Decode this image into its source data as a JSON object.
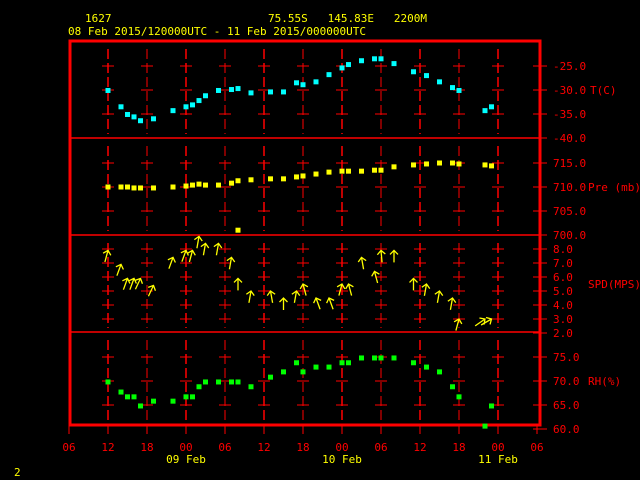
{
  "header": {
    "station": "1627",
    "location": "75.55S   145.83E   2200M",
    "period": "08 Feb 2015/120000UTC - 11 Feb 2015/000000UTC"
  },
  "footer": {
    "page": "2"
  },
  "colors": {
    "frame": "#ff0000",
    "temp": "#00ffff",
    "pres": "#ffff00",
    "wind": "#ffff00",
    "rh": "#00ff00"
  },
  "chart_data": {
    "type": "scatter",
    "title": "1627 75.55S 145.83E 2200M",
    "x_unit": "hours since 08 Feb 2015 12 UTC",
    "x_ticks": [
      "06",
      "12",
      "18",
      "00",
      "06",
      "12",
      "18",
      "00",
      "06",
      "12",
      "18",
      "00",
      "06"
    ],
    "x_tick_hours": [
      -6,
      0,
      6,
      12,
      18,
      24,
      30,
      36,
      42,
      48,
      54,
      60,
      66
    ],
    "x_dates": [
      {
        "label": "09 Feb",
        "hour": 12
      },
      {
        "label": "10 Feb",
        "hour": 36
      },
      {
        "label": "11 Feb",
        "hour": 60
      }
    ],
    "xlim": [
      -6,
      66
    ],
    "panels": [
      {
        "name": "temperature",
        "label": "T(C)",
        "ylim": [
          -40,
          -20
        ],
        "ticks": [
          "-25.0",
          "-30.0",
          "-35.0",
          "-40.0"
        ],
        "tick_values": [
          -25,
          -30,
          -35,
          -40
        ],
        "points": [
          [
            0,
            -30.1
          ],
          [
            2,
            -33.5
          ],
          [
            3,
            -35.1
          ],
          [
            4,
            -35.6
          ],
          [
            5,
            -36.4
          ],
          [
            7,
            -36.0
          ],
          [
            10,
            -34.3
          ],
          [
            12,
            -33.5
          ],
          [
            13,
            -33.1
          ],
          [
            14,
            -32.2
          ],
          [
            15,
            -31.2
          ],
          [
            17,
            -30.1
          ],
          [
            19,
            -29.9
          ],
          [
            20,
            -29.7
          ],
          [
            22,
            -30.6
          ],
          [
            25,
            -30.4
          ],
          [
            27,
            -30.4
          ],
          [
            29,
            -28.5
          ],
          [
            30,
            -28.9
          ],
          [
            32,
            -28.3
          ],
          [
            34,
            -26.8
          ],
          [
            36,
            -25.4
          ],
          [
            37,
            -24.7
          ],
          [
            39,
            -23.9
          ],
          [
            41,
            -23.5
          ],
          [
            42,
            -23.5
          ],
          [
            44,
            -24.5
          ],
          [
            47,
            -26.2
          ],
          [
            49,
            -27.0
          ],
          [
            51,
            -28.3
          ],
          [
            53,
            -29.5
          ],
          [
            54,
            -30.1
          ],
          [
            58,
            -34.3
          ],
          [
            59,
            -33.5
          ]
        ]
      },
      {
        "name": "pressure",
        "label": "Pre (mb)",
        "ylim": [
          700,
          720
        ],
        "ticks": [
          "715.0",
          "710.0",
          "705.0",
          "700.0"
        ],
        "tick_values": [
          715,
          710,
          705,
          700
        ],
        "points": [
          [
            0,
            710.0
          ],
          [
            2,
            710.0
          ],
          [
            3,
            710.0
          ],
          [
            4,
            709.8
          ],
          [
            5,
            709.8
          ],
          [
            7,
            709.8
          ],
          [
            10,
            710.0
          ],
          [
            12,
            710.2
          ],
          [
            13,
            710.4
          ],
          [
            14,
            710.6
          ],
          [
            15,
            710.4
          ],
          [
            17,
            710.4
          ],
          [
            19,
            710.8
          ],
          [
            20,
            711.3
          ],
          [
            20,
            701.0
          ],
          [
            22,
            711.5
          ],
          [
            25,
            711.7
          ],
          [
            27,
            711.7
          ],
          [
            29,
            712.1
          ],
          [
            30,
            712.3
          ],
          [
            32,
            712.7
          ],
          [
            34,
            713.1
          ],
          [
            36,
            713.3
          ],
          [
            37,
            713.3
          ],
          [
            39,
            713.3
          ],
          [
            41,
            713.5
          ],
          [
            42,
            713.5
          ],
          [
            44,
            714.2
          ],
          [
            47,
            714.6
          ],
          [
            49,
            714.8
          ],
          [
            51,
            715.0
          ],
          [
            53,
            715.0
          ],
          [
            54,
            714.8
          ],
          [
            58,
            714.6
          ],
          [
            59,
            714.4
          ]
        ]
      },
      {
        "name": "wind",
        "label": "SPD(MPS)",
        "ylim": [
          2,
          9
        ],
        "ticks": [
          "8.0",
          "7.0",
          "6.0",
          "5.0",
          "4.0",
          "3.0",
          "2.0"
        ],
        "tick_values": [
          8,
          7,
          6,
          5,
          4,
          3,
          2
        ],
        "points": [
          [
            0,
            7.9,
            15
          ],
          [
            2,
            6.9,
            20
          ],
          [
            3,
            5.9,
            20
          ],
          [
            4,
            5.9,
            20
          ],
          [
            5,
            5.9,
            25
          ],
          [
            7,
            5.4,
            25
          ],
          [
            10,
            7.4,
            20
          ],
          [
            12,
            7.9,
            20
          ],
          [
            13,
            7.9,
            15
          ],
          [
            14,
            8.9,
            10
          ],
          [
            15,
            8.4,
            10
          ],
          [
            17,
            8.4,
            10
          ],
          [
            19,
            7.4,
            10
          ],
          [
            20,
            5.9,
            0
          ],
          [
            22,
            5.0,
            10
          ],
          [
            25,
            5.0,
            -10
          ],
          [
            27,
            4.5,
            0
          ],
          [
            29,
            5.0,
            10
          ],
          [
            30,
            5.5,
            -15
          ],
          [
            32,
            4.5,
            -20
          ],
          [
            34,
            4.5,
            -20
          ],
          [
            36,
            5.5,
            15
          ],
          [
            37,
            5.5,
            -15
          ],
          [
            39,
            7.4,
            -10
          ],
          [
            41,
            6.4,
            -15
          ],
          [
            42,
            7.9,
            -5
          ],
          [
            44,
            7.9,
            0
          ],
          [
            47,
            5.9,
            0
          ],
          [
            49,
            5.5,
            10
          ],
          [
            51,
            5.0,
            10
          ],
          [
            53,
            4.5,
            10
          ],
          [
            54,
            3.0,
            15
          ],
          [
            58,
            3.0,
            55
          ],
          [
            59,
            3.0,
            60
          ]
        ]
      },
      {
        "name": "humidity",
        "label": "RH(%)",
        "ylim": [
          60,
          80
        ],
        "ticks": [
          "75.0",
          "70.0",
          "65.0",
          "60.0"
        ],
        "tick_values": [
          75,
          70,
          65,
          60
        ],
        "points": [
          [
            0,
            69.8
          ],
          [
            2,
            67.7
          ],
          [
            3,
            66.7
          ],
          [
            4,
            66.7
          ],
          [
            5,
            64.8
          ],
          [
            7,
            65.8
          ],
          [
            10,
            65.8
          ],
          [
            12,
            66.7
          ],
          [
            13,
            66.7
          ],
          [
            14,
            68.8
          ],
          [
            15,
            69.8
          ],
          [
            17,
            69.8
          ],
          [
            19,
            69.8
          ],
          [
            20,
            69.8
          ],
          [
            22,
            68.8
          ],
          [
            25,
            70.8
          ],
          [
            27,
            71.9
          ],
          [
            29,
            73.8
          ],
          [
            30,
            71.9
          ],
          [
            32,
            72.9
          ],
          [
            34,
            72.9
          ],
          [
            36,
            73.8
          ],
          [
            37,
            73.8
          ],
          [
            39,
            74.8
          ],
          [
            41,
            74.8
          ],
          [
            42,
            74.8
          ],
          [
            44,
            74.8
          ],
          [
            47,
            73.8
          ],
          [
            49,
            72.9
          ],
          [
            51,
            71.9
          ],
          [
            53,
            68.8
          ],
          [
            54,
            66.7
          ],
          [
            58,
            60.6
          ],
          [
            59,
            64.8
          ]
        ]
      }
    ]
  }
}
